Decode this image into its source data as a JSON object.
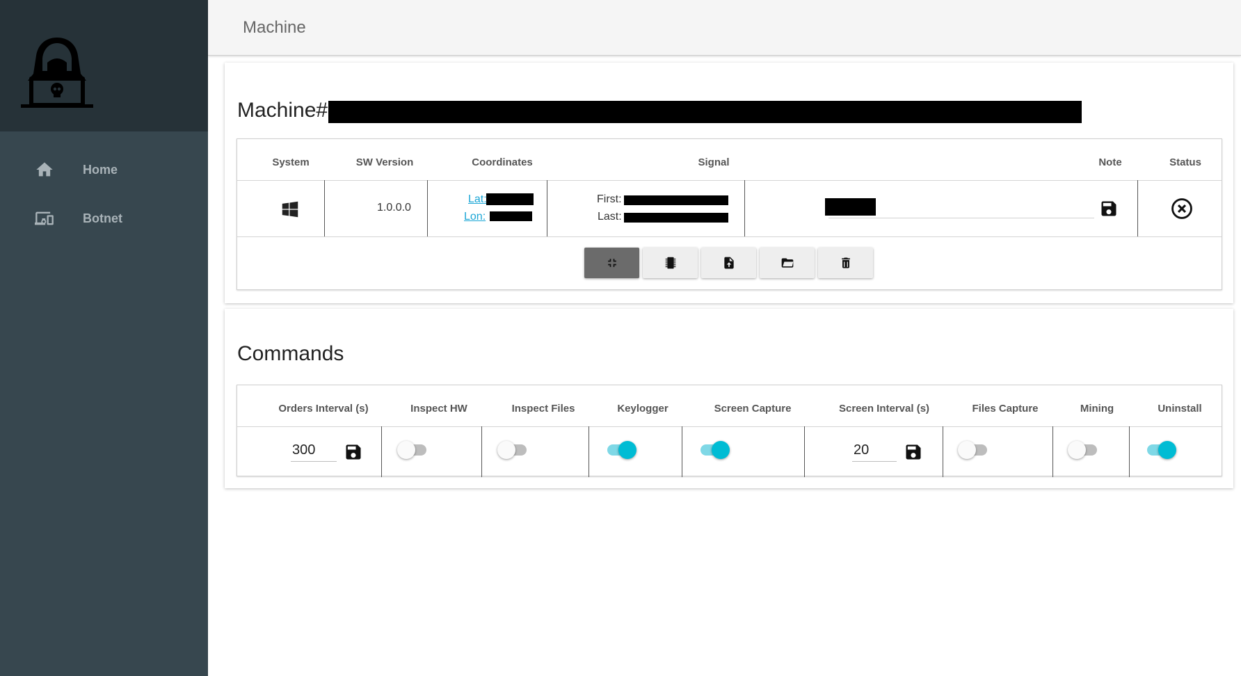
{
  "sidebar": {
    "items": [
      {
        "label": "Home",
        "icon": "home-icon"
      },
      {
        "label": "Botnet",
        "icon": "devices-icon"
      }
    ]
  },
  "header": {
    "title": "Machine"
  },
  "machine": {
    "title_prefix": "Machine#",
    "columns": [
      "System",
      "SW Version",
      "Coordinates",
      "Signal",
      "Note",
      "Status"
    ],
    "row": {
      "system_icon": "windows-icon",
      "sw_version": "1.0.0.0",
      "lat_label": "Lat:",
      "lon_label": "Lon:",
      "first_label": "First:",
      "last_label": "Last:",
      "note_save_icon": "save-icon",
      "status_icon": "close-circle-icon"
    },
    "actions": [
      {
        "name": "collapse-button",
        "icon": "collapse-icon",
        "active": true
      },
      {
        "name": "hardware-button",
        "icon": "chip-icon",
        "active": false
      },
      {
        "name": "upload-file-button",
        "icon": "file-upload-icon",
        "active": false
      },
      {
        "name": "open-folder-button",
        "icon": "folder-open-icon",
        "active": false
      },
      {
        "name": "delete-button",
        "icon": "trash-icon",
        "active": false
      }
    ]
  },
  "commands": {
    "title": "Commands",
    "columns": [
      "Orders Interval (s)",
      "Inspect HW",
      "Inspect Files",
      "Keylogger",
      "Screen Capture",
      "Screen Interval (s)",
      "Files Capture",
      "Mining",
      "Uninstall"
    ],
    "orders_interval": "300",
    "screen_interval": "20",
    "toggles": {
      "inspect_hw": false,
      "inspect_files": false,
      "keylogger": true,
      "screen_capture": true,
      "files_capture": false,
      "mining": false,
      "uninstall": true
    },
    "accent_color": "#00bcd4"
  }
}
